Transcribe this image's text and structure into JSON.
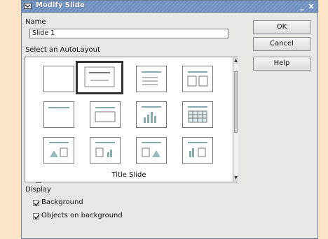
{
  "window": {
    "title": "Modify Slide",
    "minimize": "_",
    "close": "x"
  },
  "form": {
    "name_label": "Name",
    "name_value": "Slide 1",
    "layout_label": "Select an AutoLayout",
    "selected_caption": "Title Slide",
    "display_label": "Display",
    "background_label": "Background",
    "objects_background_label": "Objects on background"
  },
  "buttons": {
    "ok": "OK",
    "cancel": "Cancel",
    "help": "Help"
  },
  "layouts": [
    {
      "name": "Blank Slide",
      "icon": "blank-slide-icon"
    },
    {
      "name": "Title Slide",
      "icon": "title-slide-icon",
      "selected": true
    },
    {
      "name": "Title, Text",
      "icon": "title-text-icon"
    },
    {
      "name": "Title, 2 Text",
      "icon": "title-two-text-icon"
    },
    {
      "name": "Title Only",
      "icon": "title-only-icon"
    },
    {
      "name": "Centered Text",
      "icon": "centered-text-icon"
    },
    {
      "name": "Title, Chart",
      "icon": "title-chart-icon"
    },
    {
      "name": "Title, Table",
      "icon": "title-table-icon"
    },
    {
      "name": "Title, Clipart, Text",
      "icon": "title-clipart-text-icon"
    },
    {
      "name": "Title, Text, Chart",
      "icon": "title-text-chart-icon"
    },
    {
      "name": "Title, Text, Clipart",
      "icon": "title-text-clipart-icon"
    },
    {
      "name": "Title, Chart, Text",
      "icon": "title-chart-text-icon"
    }
  ],
  "checkboxes": {
    "background_checked": true,
    "objects_background_checked": true
  }
}
